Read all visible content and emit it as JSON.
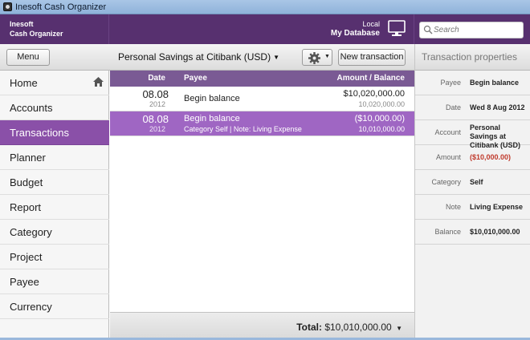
{
  "window": {
    "title": "Inesoft Cash Organizer"
  },
  "header": {
    "brand_line1": "Inesoft",
    "brand_line2": "Cash Organizer",
    "db_small": "Local",
    "db_name": "My Database",
    "search_placeholder": "Search",
    "icons": {
      "monitor": "monitor-icon",
      "search": "search-icon"
    }
  },
  "toolbar": {
    "menu_label": "Menu",
    "account": "Personal Savings at Citibank (USD)",
    "new_transaction_label": "New transaction",
    "props_title": "Transaction properties",
    "icons": {
      "gear": "gear-icon",
      "dropdown": "chevron-down-icon"
    }
  },
  "sidebar": {
    "items": [
      {
        "label": "Home",
        "icon": "home-icon"
      },
      {
        "label": "Accounts"
      },
      {
        "label": "Transactions",
        "active": true
      },
      {
        "label": "Planner"
      },
      {
        "label": "Budget"
      },
      {
        "label": "Report"
      },
      {
        "label": "Category"
      },
      {
        "label": "Project"
      },
      {
        "label": "Payee"
      },
      {
        "label": "Currency"
      }
    ]
  },
  "table": {
    "columns": [
      "Date",
      "Payee",
      "Amount / Balance"
    ],
    "rows": [
      {
        "date": "08.08",
        "year": "2012",
        "payee": "Begin balance",
        "note": "",
        "amount": "$10,020,000.00",
        "balance": "10,020,000.00"
      },
      {
        "date": "08.08",
        "year": "2012",
        "payee": "Begin balance",
        "note": "Category Self | Note: Living Expense",
        "amount": "($10,000.00)",
        "balance": "10,010,000.00",
        "selected": true
      }
    ],
    "total_label": "Total:",
    "total_value": "$10,010,000.00"
  },
  "properties": [
    {
      "key": "Payee",
      "value": "Begin balance"
    },
    {
      "key": "Date",
      "value": "Wed 8 Aug 2012"
    },
    {
      "key": "Account",
      "value": "Personal Savings at Citibank (USD)"
    },
    {
      "key": "Amount",
      "value": "($10,000.00)",
      "negative": true
    },
    {
      "key": "Category",
      "value": "Self"
    },
    {
      "key": "Note",
      "value": "Living Expense"
    },
    {
      "key": "Balance",
      "value": "$10,010,000.00"
    }
  ],
  "colors": {
    "header": "#57306f",
    "accent": "#8a50a8",
    "selected_row": "#9f66c3",
    "negative": "#c0392b"
  }
}
